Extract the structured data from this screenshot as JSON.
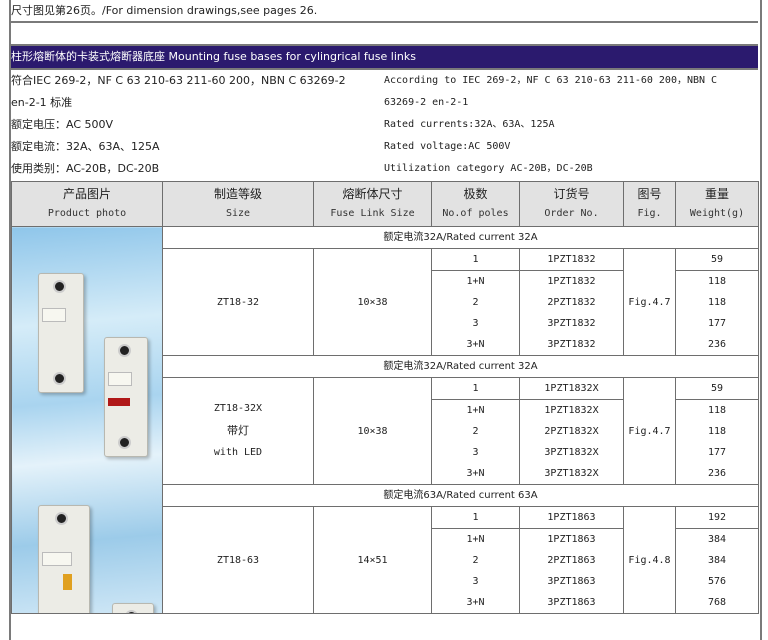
{
  "top_note": "尺寸图见第26页。/For dimension drawings,see pages 26.",
  "banner": "柱形熔断体的卡装式熔断器底座 Mounting fuse bases for cylingrical fuse links",
  "specs_cn": [
    "符合IEC 269-2，NF C 63 210-63 211-60 200，NBN C 63269-2",
    "en-2-1 标准",
    "额定电压：AC 500V",
    "额定电流：32A、63A、125A",
    "使用类别：AC-20B，DC-20B"
  ],
  "specs_en": [
    "According to IEC 269-2，NF C 63 210-63 211-60 200，NBN C",
    "63269-2 en-2-1",
    "Rated currents:32A、63A、125A",
    "Rated voltage:AC 500V",
    "Utilization category AC-20B，DC-20B"
  ],
  "table": {
    "headers": [
      {
        "cn": "产品图片",
        "en": "Product photo"
      },
      {
        "cn": "制造等级",
        "en": "Size"
      },
      {
        "cn": "熔断体尺寸",
        "en": "Fuse Link Size"
      },
      {
        "cn": "极数",
        "en": "No.of poles"
      },
      {
        "cn": "订货号",
        "en": "Order No."
      },
      {
        "cn": "图号",
        "en": "Fig."
      },
      {
        "cn": "重量",
        "en": "Weight(g)"
      }
    ],
    "photo_alt": "fuse-base-product-photo",
    "groups": [
      {
        "title": "额定电流32A/Rated current 32A",
        "size": [
          "ZT18-32"
        ],
        "fuse_link_size": "10×38",
        "fig": "Fig.4.7",
        "rows": [
          {
            "poles": "1",
            "order": "1PZT1832",
            "weight": "59"
          },
          {
            "poles": "1+N",
            "order": "1PZT1832",
            "weight": "118"
          },
          {
            "poles": "2",
            "order": "2PZT1832",
            "weight": "118"
          },
          {
            "poles": "3",
            "order": "3PZT1832",
            "weight": "177"
          },
          {
            "poles": "3+N",
            "order": "3PZT1832",
            "weight": "236"
          }
        ]
      },
      {
        "title": "额定电流32A/Rated current 32A",
        "size": [
          "ZT18-32X",
          "带灯",
          "with LED"
        ],
        "fuse_link_size": "10×38",
        "fig": "Fig.4.7",
        "rows": [
          {
            "poles": "1",
            "order": "1PZT1832X",
            "weight": "59"
          },
          {
            "poles": "1+N",
            "order": "1PZT1832X",
            "weight": "118"
          },
          {
            "poles": "2",
            "order": "2PZT1832X",
            "weight": "118"
          },
          {
            "poles": "3",
            "order": "3PZT1832X",
            "weight": "177"
          },
          {
            "poles": "3+N",
            "order": "3PZT1832X",
            "weight": "236"
          }
        ]
      },
      {
        "title": "额定电流63A/Rated current 63A",
        "size": [
          "ZT18-63"
        ],
        "fuse_link_size": "14×51",
        "fig": "Fig.4.8",
        "rows": [
          {
            "poles": "1",
            "order": "1PZT1863",
            "weight": "192"
          },
          {
            "poles": "1+N",
            "order": "1PZT1863",
            "weight": "384"
          },
          {
            "poles": "2",
            "order": "2PZT1863",
            "weight": "384"
          },
          {
            "poles": "3",
            "order": "3PZT1863",
            "weight": "576"
          },
          {
            "poles": "3+N",
            "order": "3PZT1863",
            "weight": "768"
          }
        ]
      }
    ]
  },
  "colors": {
    "banner_bg": "#2b1a6e",
    "header_bg": "#e2e2e2",
    "border": "#6e6e6e"
  }
}
